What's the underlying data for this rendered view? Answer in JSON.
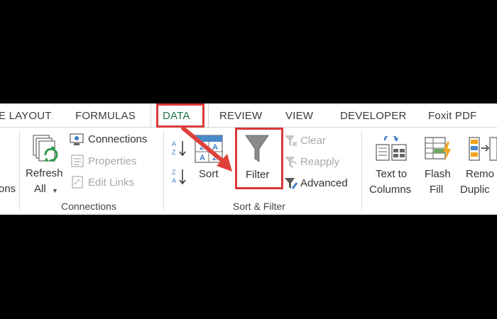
{
  "tabs": {
    "page_layout": "E LAYOUT",
    "formulas": "FORMULAS",
    "data": "DATA",
    "review": "REVIEW",
    "view": "VIEW",
    "developer": "DEVELOPER",
    "foxit": "Foxit PDF"
  },
  "connections_group": {
    "refresh_line1": "Refresh",
    "refresh_line2": "All",
    "connections": "Connections",
    "properties": "Properties",
    "edit_links": "Edit Links",
    "label": "Connections"
  },
  "left_cut": {
    "text": "ons"
  },
  "sort_filter_group": {
    "sort": "Sort",
    "filter": "Filter",
    "clear": "Clear",
    "reapply": "Reapply",
    "advanced": "Advanced",
    "label": "Sort & Filter"
  },
  "data_tools": {
    "text_to_columns_line1": "Text to",
    "text_to_columns_line2": "Columns",
    "flash_fill_line1": "Flash",
    "flash_fill_line2": "Fill",
    "remove_duplicates_line1": "Remo",
    "remove_duplicates_line2": "Duplic"
  },
  "colors": {
    "accent_green": "#217346",
    "highlight_red": "#d9393a"
  },
  "icons": [
    "refresh-icon",
    "connections-icon",
    "properties-icon",
    "edit-links-icon",
    "sort-az-icon",
    "sort-za-icon",
    "sort-icon",
    "filter-funnel-icon",
    "clear-filter-icon",
    "reapply-icon",
    "advanced-filter-icon",
    "text-to-columns-icon",
    "flash-fill-icon",
    "remove-duplicates-icon",
    "red-arrow-annotation"
  ]
}
